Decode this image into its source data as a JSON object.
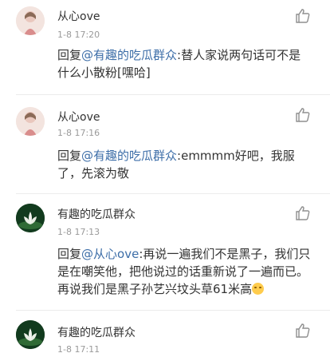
{
  "comments": [
    {
      "user": "从心ove",
      "time": "1-8 17:20",
      "reply_prefix": "回复",
      "mention": "@有趣的吃瓜群众",
      "text": ":替人家说两句话可不是什么小散粉[嘿哈]",
      "avatar": "girl-avatar"
    },
    {
      "user": "从心ove",
      "time": "1-8 17:16",
      "reply_prefix": "回复",
      "mention": "@有趣的吃瓜群众",
      "text": ":emmmm好吧，我服了，先滚为敬",
      "avatar": "girl-avatar"
    },
    {
      "user": "有趣的吃瓜群众",
      "time": "1-8 17:13",
      "reply_prefix": "回复",
      "mention": "@从心ove",
      "text": ":再说一遍我们不是黑子，我们只是在嘲笑他，把他说过的话重新说了一遍而已。再说我们是黑子孙艺兴坟头草61米高",
      "avatar": "lotus-avatar"
    },
    {
      "user": "有趣的吃瓜群众",
      "time": "1-8 17:11",
      "avatar": "lotus-avatar"
    }
  ],
  "icons": {
    "like": "thumbs-up-icon"
  },
  "colors": {
    "mention": "#3d6ea8",
    "time": "#9a9a9a"
  }
}
